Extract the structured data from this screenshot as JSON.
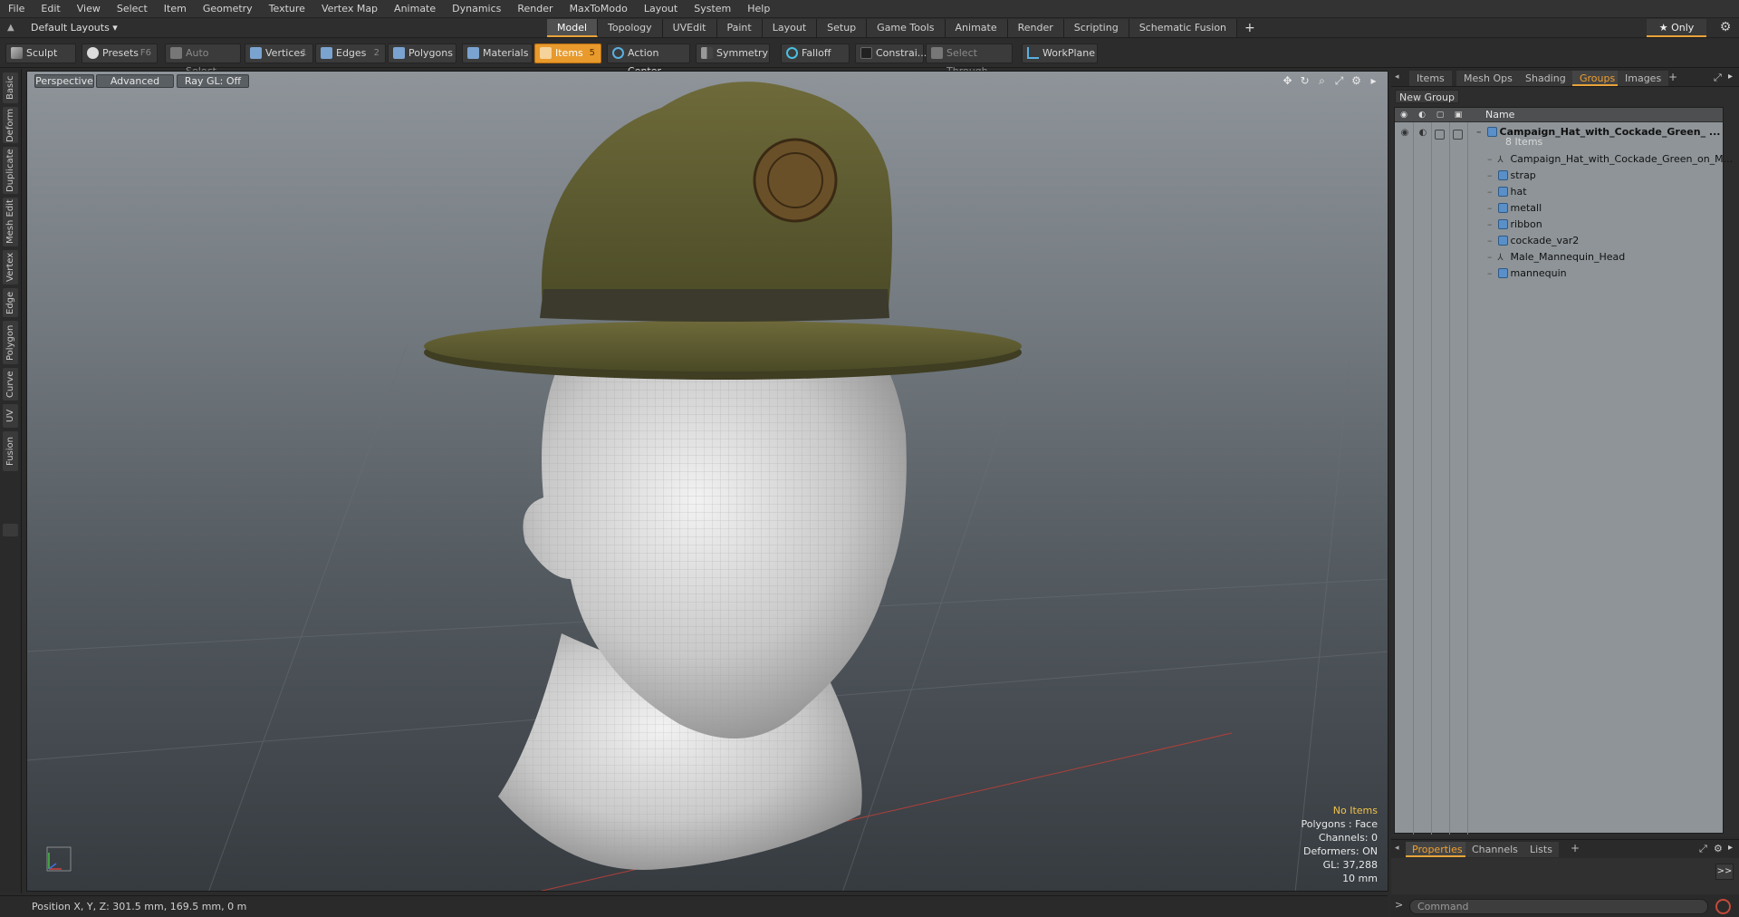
{
  "menu": [
    "File",
    "Edit",
    "View",
    "Select",
    "Item",
    "Geometry",
    "Texture",
    "Vertex Map",
    "Animate",
    "Dynamics",
    "Render",
    "MaxToModo",
    "Layout",
    "System",
    "Help"
  ],
  "layout": {
    "dropdown": "Default Layouts ▾",
    "tabs": [
      "Model",
      "Topology",
      "UVEdit",
      "Paint",
      "Layout",
      "Setup",
      "Game Tools",
      "Animate",
      "Render",
      "Scripting",
      "Schematic Fusion"
    ],
    "active_tab": "Model",
    "add": "+",
    "only": "★  Only"
  },
  "toolbar": {
    "sculpt": "Sculpt",
    "presets": "Presets",
    "presets_key": "F6",
    "auto_select": "Auto Select",
    "vertices": "Vertices",
    "vertices_key": "1",
    "edges": "Edges",
    "edges_key": "2",
    "polygons": "Polygons",
    "materials": "Materials",
    "items": "Items",
    "items_key": "5",
    "action_center": "Action Center",
    "symmetry": "Symmetry",
    "falloff": "Falloff",
    "constrain": "Constrai...",
    "select_through": "Select Through",
    "workplane": "WorkPlane"
  },
  "left_tabs": [
    "Basic",
    "Deform",
    "Duplicate",
    "Mesh Edit",
    "Vertex",
    "Edge",
    "Polygon",
    "Curve",
    "UV",
    "Fusion"
  ],
  "viewport": {
    "perspective": "Perspective",
    "advanced": "Advanced",
    "raygl": "Ray GL: Off",
    "stats": {
      "items": "No Items",
      "polygons": "Polygons : Face",
      "channels": "Channels: 0",
      "deformers": "Deformers: ON",
      "gl": "GL: 37,288",
      "grid": "10 mm"
    }
  },
  "right_panel": {
    "tabs": [
      "Items",
      "Mesh Ops",
      "Shading",
      "Groups",
      "Images"
    ],
    "active_tab": "Groups",
    "add": "+",
    "new_group": "New Group",
    "name_header": "Name",
    "group": {
      "name": "Campaign_Hat_with_Cockade_Green_ ...",
      "count": "8 Items"
    },
    "rows": [
      {
        "label": "Campaign_Hat_with_Cockade_Green_on_M...",
        "icon": "locator-icon"
      },
      {
        "label": "strap",
        "icon": "mesh-icon"
      },
      {
        "label": "hat",
        "icon": "mesh-icon"
      },
      {
        "label": "metall",
        "icon": "mesh-icon"
      },
      {
        "label": "ribbon",
        "icon": "mesh-icon"
      },
      {
        "label": "cockade_var2",
        "icon": "mesh-icon"
      },
      {
        "label": "Male_Mannequin_Head",
        "icon": "locator-icon"
      },
      {
        "label": "mannequin",
        "icon": "mesh-icon"
      }
    ]
  },
  "bottom_panel": {
    "tabs": [
      "Properties",
      "Channels",
      "Lists"
    ],
    "active_tab": "Properties",
    "add": "+",
    "expand": ">>"
  },
  "status": {
    "position": "Position X, Y, Z:   301.5 mm, 169.5 mm, 0 m"
  },
  "command": {
    "prompt": ">",
    "placeholder": "Command"
  }
}
